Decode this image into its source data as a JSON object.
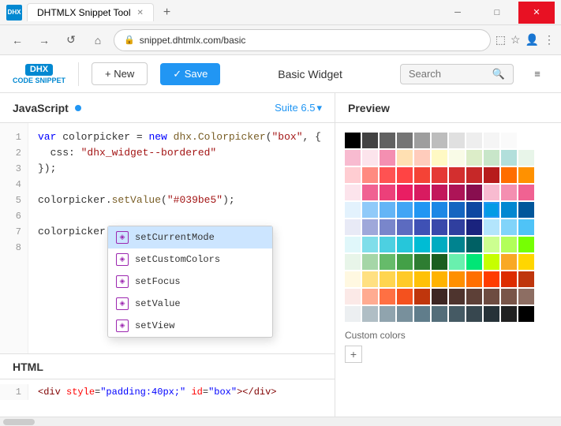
{
  "titlebar": {
    "logo": "DHX",
    "title": "DHTMLX Snippet Tool",
    "close_label": "✕",
    "minimize_label": "─",
    "maximize_label": "□",
    "new_tab_label": "+"
  },
  "addressbar": {
    "url": "snippet.dhtmlx.com/basic",
    "back": "←",
    "forward": "→",
    "refresh": "↺",
    "home": "⌂"
  },
  "toolbar": {
    "logo_top": "DHX",
    "logo_bottom": "CODE SNIPPET",
    "new_label": "+ New",
    "save_label": "✓ Save",
    "snippet_title": "Basic Widget",
    "search_placeholder": "Search",
    "filter_icon": "≡"
  },
  "left_panel": {
    "title": "JavaScript",
    "suite_label": "Suite 6.5",
    "code_lines": [
      {
        "num": "1",
        "text": "var colorpicker = new dhx.Colorpicker(\"box\", {"
      },
      {
        "num": "2",
        "text": "  css: \"dhx_widget--bordered\""
      },
      {
        "num": "3",
        "text": "});"
      },
      {
        "num": "4",
        "text": ""
      },
      {
        "num": "5",
        "text": "colorpicker.setValue(\"#039be5\");"
      },
      {
        "num": "6",
        "text": ""
      },
      {
        "num": "7",
        "text": "colorpicker.set"
      },
      {
        "num": "8",
        "text": ""
      }
    ],
    "autocomplete": [
      "setCurrentMode",
      "setCustomColors",
      "setFocus",
      "setValue",
      "setView"
    ]
  },
  "html_panel": {
    "title": "HTML",
    "code_lines": [
      {
        "num": "1",
        "text": "<div style=\"padding:40px;\" id=\"box\"></div>"
      }
    ]
  },
  "right_panel": {
    "title": "Preview",
    "custom_colors_label": "Custom colors",
    "add_btn": "+"
  },
  "color_grid": {
    "colors": [
      [
        "#000000",
        "#424242",
        "#616161",
        "#757575",
        "#9e9e9e",
        "#bdbdbd",
        "#e0e0e0",
        "#eeeeee",
        "#f5f5f5",
        "#fafafa",
        "#ffffff"
      ],
      [
        "#f8bbd0",
        "#fce4ec",
        "#f48fb1",
        "#ffe0b2",
        "#ffccbc",
        "#fff9c4",
        "#f9fbe7",
        "#dcedc8",
        "#c8e6c9",
        "#b2dfdb",
        "#e8f5e9"
      ],
      [
        "#ffcdd2",
        "#ff8a80",
        "#ff5252",
        "#ff4444",
        "#f44336",
        "#e53935",
        "#d32f2f",
        "#c62828",
        "#b71c1c",
        "#ff6d00",
        "#ff9100"
      ],
      [
        "#fce4ec",
        "#f06292",
        "#ec407a",
        "#e91e63",
        "#d81b60",
        "#c2185b",
        "#ad1457",
        "#880e4f",
        "#f8bbd0",
        "#f48fb1",
        "#f06292"
      ],
      [
        "#e3f2fd",
        "#90caf9",
        "#64b5f6",
        "#42a5f5",
        "#2196f3",
        "#1e88e5",
        "#1565c0",
        "#0d47a1",
        "#039be5",
        "#0288d1",
        "#01579b"
      ],
      [
        "#e8eaf6",
        "#9fa8da",
        "#7986cb",
        "#5c6bc0",
        "#3f51b5",
        "#3949ab",
        "#303f9f",
        "#1a237e",
        "#b3e5fc",
        "#81d4fa",
        "#4fc3f7"
      ],
      [
        "#e0f7fa",
        "#80deea",
        "#4dd0e1",
        "#26c6da",
        "#00bcd4",
        "#00acc1",
        "#00838f",
        "#006064",
        "#ccff90",
        "#b2ff59",
        "#76ff03"
      ],
      [
        "#e8f5e9",
        "#a5d6a7",
        "#66bb6a",
        "#43a047",
        "#2e7d32",
        "#1b5e20",
        "#69f0ae",
        "#00e676",
        "#c6ff00",
        "#f9a825",
        "#ffd600"
      ],
      [
        "#fff8e1",
        "#ffe082",
        "#ffd54f",
        "#ffca28",
        "#ffc107",
        "#ffb300",
        "#ff8f00",
        "#ff6f00",
        "#ff3d00",
        "#dd2c00",
        "#bf360c"
      ],
      [
        "#fbe9e7",
        "#ffab91",
        "#ff7043",
        "#f4511e",
        "#bf360c",
        "#3e2723",
        "#4e342e",
        "#5d4037",
        "#6d4c41",
        "#795548",
        "#8d6e63"
      ],
      [
        "#eceff1",
        "#b0bec5",
        "#90a4ae",
        "#78909c",
        "#607d8b",
        "#546e7a",
        "#455a64",
        "#37474f",
        "#263238",
        "#212121",
        "#000000"
      ]
    ],
    "selected_color": "#039be5"
  }
}
